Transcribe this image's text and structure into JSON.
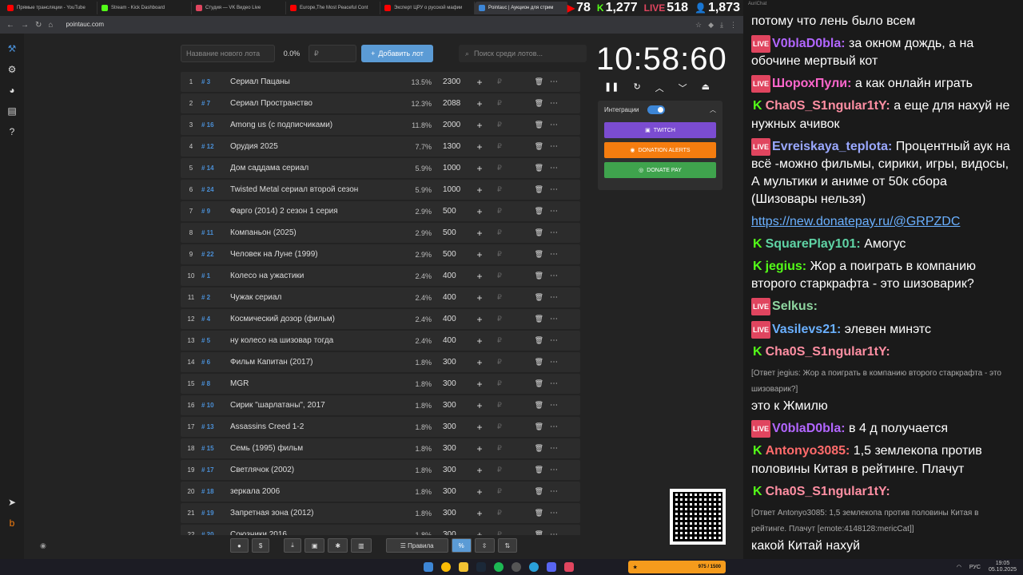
{
  "browser": {
    "tabs": [
      {
        "label": "Прямые трансляции - YouTube",
        "color": "#ff0000"
      },
      {
        "label": "Stream - Kick Dashboard",
        "color": "#53fc18"
      },
      {
        "label": "Студия — VK Видео Live",
        "color": "#e0455f"
      },
      {
        "label": "Europe,The Most Peaceful Cont",
        "color": "#ff0000"
      },
      {
        "label": "Эксперт ЦРУ о русской мафии",
        "color": "#ff0000"
      },
      {
        "label": "Pointauc | Аукцион для стрим",
        "color": "#3d86d6"
      }
    ],
    "url": "pointauc.com",
    "stats": [
      {
        "icon": "youtube-icon",
        "value": "78"
      },
      {
        "icon": "kick-icon",
        "value": "1,277"
      },
      {
        "icon": "vk-live-icon",
        "value": "518"
      },
      {
        "icon": "viewers-icon",
        "value": "1,873"
      }
    ]
  },
  "controls": {
    "new_lot_placeholder": "Название нового лота",
    "percent": "0.0%",
    "amount_placeholder": "₽",
    "add_label": "Добавить лот",
    "search_placeholder": "Поиск среди лотов..."
  },
  "lots": [
    {
      "idx": "1",
      "num": "# 3",
      "name": "Сериал Пацаны",
      "percent": "13.5%",
      "amount": "2300"
    },
    {
      "idx": "2",
      "num": "# 7",
      "name": "Сериал Пространство",
      "percent": "12.3%",
      "amount": "2088"
    },
    {
      "idx": "3",
      "num": "# 16",
      "name": "Among us (с подписчиками)",
      "percent": "11.8%",
      "amount": "2000"
    },
    {
      "idx": "4",
      "num": "# 12",
      "name": "Орудия 2025",
      "percent": "7.7%",
      "amount": "1300"
    },
    {
      "idx": "5",
      "num": "# 14",
      "name": "Дом саддама сериал",
      "percent": "5.9%",
      "amount": "1000"
    },
    {
      "idx": "6",
      "num": "# 24",
      "name": "Twisted Metal сериал второй сезон",
      "percent": "5.9%",
      "amount": "1000"
    },
    {
      "idx": "7",
      "num": "# 9",
      "name": "Фарго (2014) 2 сезон 1 серия",
      "percent": "2.9%",
      "amount": "500"
    },
    {
      "idx": "8",
      "num": "# 11",
      "name": "Компаньон (2025)",
      "percent": "2.9%",
      "amount": "500"
    },
    {
      "idx": "9",
      "num": "# 22",
      "name": "Человек на Луне (1999)",
      "percent": "2.9%",
      "amount": "500"
    },
    {
      "idx": "10",
      "num": "# 1",
      "name": "Колесо на ужастики",
      "percent": "2.4%",
      "amount": "400"
    },
    {
      "idx": "11",
      "num": "# 2",
      "name": "Чужак сериал",
      "percent": "2.4%",
      "amount": "400"
    },
    {
      "idx": "12",
      "num": "# 4",
      "name": "Космический дозор (фильм)",
      "percent": "2.4%",
      "amount": "400"
    },
    {
      "idx": "13",
      "num": "# 5",
      "name": "ну колесо на шизовар тогда",
      "percent": "2.4%",
      "amount": "400"
    },
    {
      "idx": "14",
      "num": "# 6",
      "name": "Фильм Капитан (2017)",
      "percent": "1.8%",
      "amount": "300"
    },
    {
      "idx": "15",
      "num": "# 8",
      "name": "MGR",
      "percent": "1.8%",
      "amount": "300"
    },
    {
      "idx": "16",
      "num": "# 10",
      "name": "Сирик \"шарлатаны\", 2017",
      "percent": "1.8%",
      "amount": "300"
    },
    {
      "idx": "17",
      "num": "# 13",
      "name": "Assassins Creed 1-2",
      "percent": "1.8%",
      "amount": "300"
    },
    {
      "idx": "18",
      "num": "# 15",
      "name": "Семь (1995) фильм",
      "percent": "1.8%",
      "amount": "300"
    },
    {
      "idx": "19",
      "num": "# 17",
      "name": "Светлячок (2002)",
      "percent": "1.8%",
      "amount": "300"
    },
    {
      "idx": "20",
      "num": "# 18",
      "name": "зеркала 2006",
      "percent": "1.8%",
      "amount": "300"
    },
    {
      "idx": "21",
      "num": "# 19",
      "name": "Запретная зона (2012)",
      "percent": "1.8%",
      "amount": "300"
    },
    {
      "idx": "22",
      "num": "# 20",
      "name": "Союзники 2016",
      "percent": "1.8%",
      "amount": "300"
    }
  ],
  "timer": {
    "value": "10:58:60"
  },
  "integrations": {
    "label": "Интеграции",
    "twitch": "TWITCH",
    "donation_alerts": "DONATION ALERTS",
    "donate_pay": "DONATE PAY",
    "twitch_color": "#7b4cd1",
    "da_color": "#f57d0f",
    "dp_color": "#3fa34d"
  },
  "bottombar": {
    "rules": "Правила"
  },
  "chat": {
    "title": "AuriChat",
    "messages": [
      {
        "badge": "",
        "user": "",
        "color": "#ffffff",
        "text": "потому что лень было всем"
      },
      {
        "badge": "live",
        "user": "V0blaD0bla:",
        "color": "#b266ff",
        "text": " за окном дождь, а на обочине мертвый кот"
      },
      {
        "badge": "live",
        "user": "ШорохПули:",
        "color": "#ff66cc",
        "text": " а как онлайн играть"
      },
      {
        "badge": "kick",
        "user": "Cha0S_S1ngular1tY:",
        "color": "#ff8fa3",
        "text": " а еще для нахуй не нужных ачивок"
      },
      {
        "badge": "live",
        "user": "Evreiskaya_teplota:",
        "color": "#9aa8ff",
        "text": " Процентный аук на всё -можно фильмы, сирики, игры, видосы, А мультики и аниме от 50к сбора (Шизовары нельзя)"
      },
      {
        "badge": "",
        "user": "",
        "color": "#6ab0ff",
        "text": "https://new.donatepay.ru/@GRPZDC"
      },
      {
        "badge": "kick",
        "user": "SquarePlay101:",
        "color": "#5fd3a5",
        "text": " Амогус"
      },
      {
        "badge": "kick",
        "user": "jegius:",
        "color": "#53fc18",
        "text": " Жор а поиграть в компанию второго старкрафта - это шизоварик?"
      },
      {
        "badge": "live",
        "user": "Selkus:",
        "color": "#8fd6a0",
        "text": ""
      },
      {
        "badge": "live",
        "user": "Vasilevs21:",
        "color": "#6ab0ff",
        "text": " элевен минэтс"
      },
      {
        "badge": "kick",
        "user": "Cha0S_S1ngular1tY:",
        "color": "#ff8fa3",
        "text": ""
      },
      {
        "badge": "",
        "user": "",
        "color": "#aaaaaa",
        "reply": "[Ответ jegius: Жор а поиграть в компанию второго старкрафта - это шизоварик?]",
        "text": "это к Жмилю"
      },
      {
        "badge": "live",
        "user": "V0blaD0bla:",
        "color": "#b266ff",
        "text": " в 4 д получается"
      },
      {
        "badge": "kick",
        "user": "Antonyo3085:",
        "color": "#ff6b6b",
        "text": " 1,5 землекопа против половины Китая в рейтинге. Плачут"
      },
      {
        "badge": "kick",
        "user": "Cha0S_S1ngular1tY:",
        "color": "#ff8fa3",
        "text": ""
      },
      {
        "badge": "",
        "user": "",
        "color": "#aaaaaa",
        "reply": "[Ответ Antonyo3085: 1,5 землекопа против половины Китая в рейтинге. Плачут [emote:4148128:mericCat]]",
        "text": "какой Китай нахуй"
      }
    ]
  },
  "taskbar": {
    "lang": "РУС",
    "time": "19:05",
    "date": "05.10.2025",
    "tray": "975 / 1500"
  }
}
